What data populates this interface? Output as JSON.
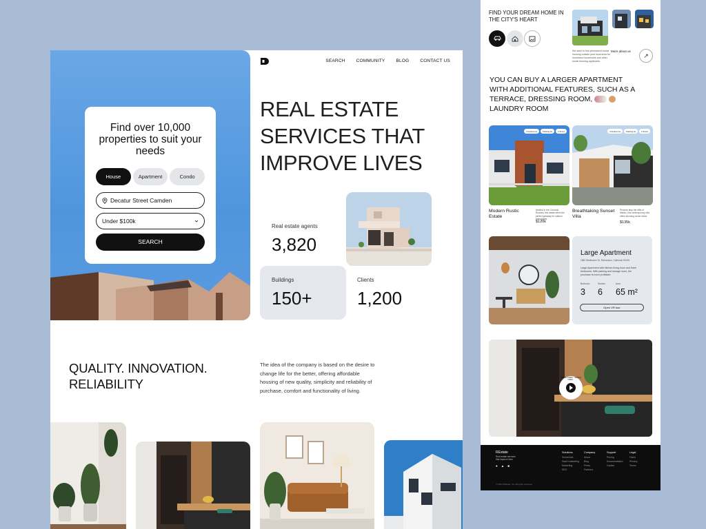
{
  "nav": {
    "items": [
      "SEARCH",
      "COMMUNITY",
      "BLOG",
      "CONTACT US"
    ]
  },
  "search": {
    "title": "Find over 10,000 properties to suit your needs",
    "types": [
      "House",
      "Apartment",
      "Condo"
    ],
    "active_type": "House",
    "location": "Decatur Street Camden",
    "price": "Under $100k",
    "button": "SEARCH"
  },
  "hero": {
    "headline": "REAL ESTATE SERVICES THAT IMPROVE LIVES"
  },
  "stats": {
    "agents_label": "Real estate agents",
    "agents_value": "3,820",
    "buildings_label": "Buildings",
    "buildings_value": "150+",
    "clients_label": "Clients",
    "clients_value": "1,200"
  },
  "about": {
    "title": "QUALITY. INNOVATION. RELIABILITY",
    "text": "The idea of the company is based on the desire to change life for the better, offering affordable housing of new quality, simplicity and reliability of purchase, comfort and functionality of living."
  },
  "side": {
    "title": "FIND YOUR DREAM HOME IN THE CITY'S HEART",
    "blurb": "We seek to find permanent social housing outside your local area for homeless households and other social housing applicants.",
    "more": "More about us",
    "headline": "YOU CAN BUY A LARGER APARTMENT WITH ADDITIONAL FEATURES, SUCH AS A TERRACE, DRESSING ROOM,",
    "headline_end": "LAUNDRY ROOM",
    "listings": [
      {
        "name": "Modern Rustic Estate",
        "desc": "Nestled in the Colorado Rockies, this estate offers the perfect getaway for outdoor enthusiasts.",
        "price": "$120k",
        "tags": [
          "3 bedrooms",
          "Parking lot",
          "2 floors"
        ]
      },
      {
        "name": "Breathtaking Sunset Villa",
        "desc": "Perched atop the cliffs of Malibu, this contemporary villa offers stunning ocean views.",
        "price": "$135k",
        "tags": [
          "3 bedrooms",
          "Parking lot",
          "2 floors"
        ]
      }
    ],
    "apartment": {
      "title": "Large Apartment",
      "address": "1850 Westhaven Dr, Richardson, California 92108",
      "desc": "Large Apartment with kitchen-living room and three bedrooms. With parking and storage room, the purchase is more profitable.",
      "labels": [
        "Bedroom",
        "Section",
        "Area"
      ],
      "values": [
        "3",
        "6",
        "65 m²"
      ],
      "button": "Open VR tour"
    },
    "video_badge": "WATCH VIDEO · WATCH VIDEO ·",
    "footer": {
      "brand": "REstate",
      "tagline": "Real estate services that improve lives",
      "columns": [
        {
          "title": "Solutions",
          "items": [
            "Social Ads",
            "SaaS marketing",
            "Marketing",
            "SEO"
          ]
        },
        {
          "title": "Company",
          "items": [
            "About",
            "Blog",
            "Press",
            "Partners"
          ]
        },
        {
          "title": "Support",
          "items": [
            "Pricing",
            "Documentation",
            "Guides"
          ]
        },
        {
          "title": "Legal",
          "items": [
            "Claim",
            "Privacy",
            "Terms"
          ]
        }
      ],
      "copyright": "© 2024 REstate, Inc. All rights reserved."
    }
  }
}
